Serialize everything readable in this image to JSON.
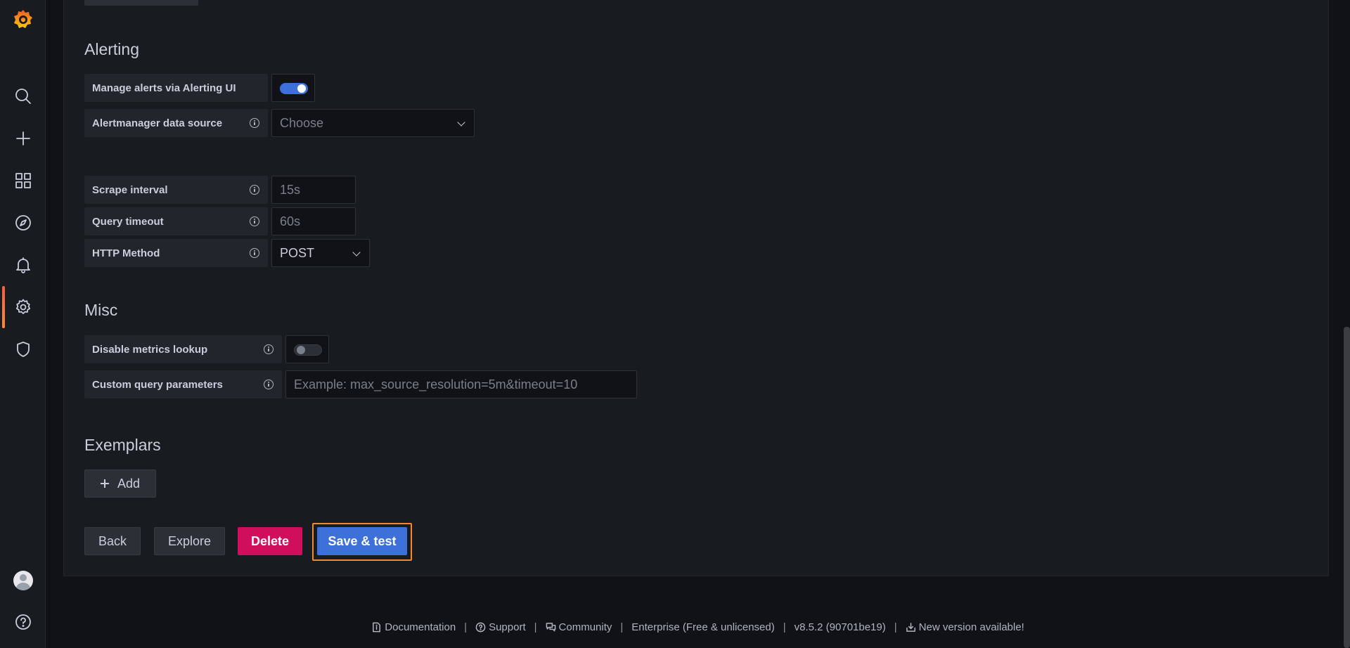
{
  "sidebar": {
    "items": [
      {
        "name": "search",
        "icon": "search-icon"
      },
      {
        "name": "create",
        "icon": "plus-icon"
      },
      {
        "name": "dashboards",
        "icon": "apps-icon"
      },
      {
        "name": "explore",
        "icon": "compass-icon"
      },
      {
        "name": "alerting",
        "icon": "bell-icon"
      },
      {
        "name": "configuration",
        "icon": "gear-icon",
        "active": true
      },
      {
        "name": "server-admin",
        "icon": "shield-icon"
      }
    ],
    "bottom": [
      {
        "name": "profile",
        "icon": "avatar"
      },
      {
        "name": "help",
        "icon": "question-circle-icon"
      }
    ],
    "accent": "#f55f3e"
  },
  "alerting": {
    "title": "Alerting",
    "manage_alerts_label": "Manage alerts via Alerting UI",
    "manage_alerts_enabled": true,
    "alertmanager_label": "Alertmanager data source",
    "alertmanager_placeholder": "Choose"
  },
  "settings": {
    "scrape_interval_label": "Scrape interval",
    "scrape_interval_placeholder": "15s",
    "query_timeout_label": "Query timeout",
    "query_timeout_placeholder": "60s",
    "http_method_label": "HTTP Method",
    "http_method_value": "POST"
  },
  "misc": {
    "title": "Misc",
    "disable_metrics_label": "Disable metrics lookup",
    "disable_metrics_enabled": false,
    "custom_query_label": "Custom query parameters",
    "custom_query_placeholder": "Example: max_source_resolution=5m&timeout=10"
  },
  "exemplars": {
    "title": "Exemplars",
    "add_label": "Add"
  },
  "actions": {
    "back": "Back",
    "explore": "Explore",
    "delete": "Delete",
    "save_test": "Save & test"
  },
  "footer": {
    "documentation": "Documentation",
    "support": "Support",
    "community": "Community",
    "edition": "Enterprise (Free & unlicensed)",
    "version": "v8.5.2 (90701be19)",
    "update": "New version available!",
    "separator": "|"
  },
  "colors": {
    "primary": "#3d71d9",
    "danger": "#d10e5c",
    "focus": "#f0892f",
    "background": "#111217",
    "panel": "#181b1f"
  }
}
